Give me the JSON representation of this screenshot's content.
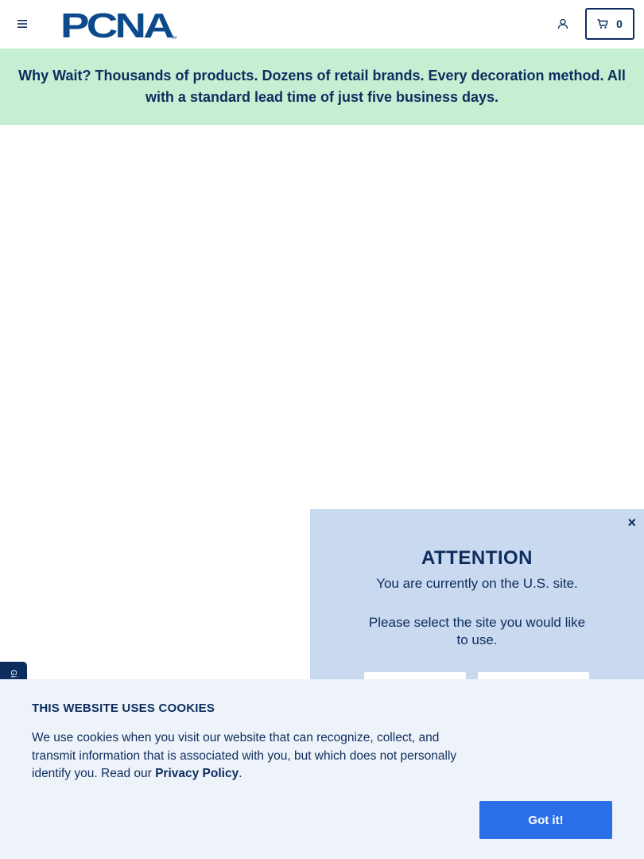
{
  "header": {
    "logo_text": "PCNA",
    "logo_tm": "TM",
    "cart_count": "0",
    "brand_color": "#0d2d5e"
  },
  "banner": {
    "text": "Why Wait? Thousands of products. Dozens of retail brands. Every decoration method. All with a standard lead time of just five business days.",
    "background": "#c5eed3"
  },
  "side_tab": {
    "label": "Gi"
  },
  "attention_modal": {
    "close_label": "×",
    "title": "ATTENTION",
    "line1": "You are currently on the U.S. site.",
    "line2": "Please select the site you would like to use."
  },
  "cookie_notice": {
    "title": "THIS WEBSITE USES COOKIES",
    "text": "We use cookies when you visit our website that can recognize, collect, and transmit information that is associated with you, but which does not personally identify you. Read our ",
    "link_label": "Privacy Policy",
    "text_end": ".",
    "button_label": "Got it!",
    "button_color": "#2b6fe8"
  }
}
